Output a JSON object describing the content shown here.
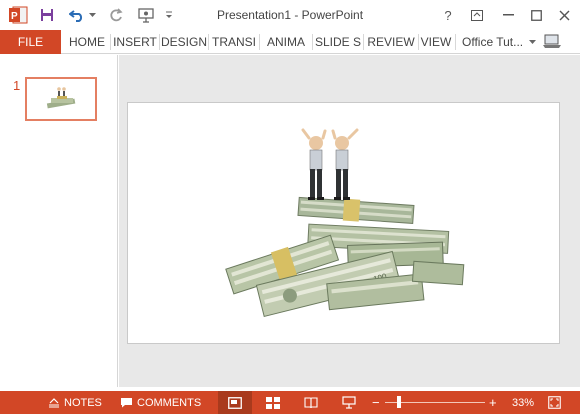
{
  "window": {
    "title": "Presentation1 - PowerPoint",
    "help_label": "?"
  },
  "ribbon": {
    "file_label": "FILE",
    "tabs": [
      "HOME",
      "INSERT",
      "DESIGN",
      "TRANSI",
      "ANIMA",
      "SLIDE S",
      "REVIEW",
      "VIEW"
    ],
    "account_label": "Office Tut..."
  },
  "thumbnails": {
    "slide_number": "1"
  },
  "statusbar": {
    "notes_label": "NOTES",
    "comments_label": "COMMENTS",
    "zoom_out_label": "−",
    "zoom_in_label": "+",
    "zoom_value": "33%"
  },
  "colors": {
    "accent": "#d24726",
    "accent_dark": "#a93a1d",
    "canvas": "#e8e8e8"
  }
}
